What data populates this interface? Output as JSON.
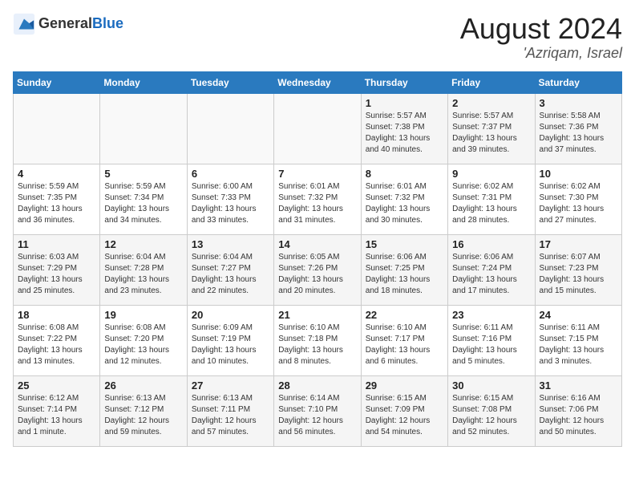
{
  "header": {
    "logo_general": "General",
    "logo_blue": "Blue",
    "month_year": "August 2024",
    "location": "'Azriqam, Israel"
  },
  "days_of_week": [
    "Sunday",
    "Monday",
    "Tuesday",
    "Wednesday",
    "Thursday",
    "Friday",
    "Saturday"
  ],
  "weeks": [
    [
      {
        "day": "",
        "sunrise": "",
        "sunset": "",
        "daylight": ""
      },
      {
        "day": "",
        "sunrise": "",
        "sunset": "",
        "daylight": ""
      },
      {
        "day": "",
        "sunrise": "",
        "sunset": "",
        "daylight": ""
      },
      {
        "day": "",
        "sunrise": "",
        "sunset": "",
        "daylight": ""
      },
      {
        "day": "1",
        "sunrise": "Sunrise: 5:57 AM",
        "sunset": "Sunset: 7:38 PM",
        "daylight": "Daylight: 13 hours and 40 minutes."
      },
      {
        "day": "2",
        "sunrise": "Sunrise: 5:57 AM",
        "sunset": "Sunset: 7:37 PM",
        "daylight": "Daylight: 13 hours and 39 minutes."
      },
      {
        "day": "3",
        "sunrise": "Sunrise: 5:58 AM",
        "sunset": "Sunset: 7:36 PM",
        "daylight": "Daylight: 13 hours and 37 minutes."
      }
    ],
    [
      {
        "day": "4",
        "sunrise": "Sunrise: 5:59 AM",
        "sunset": "Sunset: 7:35 PM",
        "daylight": "Daylight: 13 hours and 36 minutes."
      },
      {
        "day": "5",
        "sunrise": "Sunrise: 5:59 AM",
        "sunset": "Sunset: 7:34 PM",
        "daylight": "Daylight: 13 hours and 34 minutes."
      },
      {
        "day": "6",
        "sunrise": "Sunrise: 6:00 AM",
        "sunset": "Sunset: 7:33 PM",
        "daylight": "Daylight: 13 hours and 33 minutes."
      },
      {
        "day": "7",
        "sunrise": "Sunrise: 6:01 AM",
        "sunset": "Sunset: 7:32 PM",
        "daylight": "Daylight: 13 hours and 31 minutes."
      },
      {
        "day": "8",
        "sunrise": "Sunrise: 6:01 AM",
        "sunset": "Sunset: 7:32 PM",
        "daylight": "Daylight: 13 hours and 30 minutes."
      },
      {
        "day": "9",
        "sunrise": "Sunrise: 6:02 AM",
        "sunset": "Sunset: 7:31 PM",
        "daylight": "Daylight: 13 hours and 28 minutes."
      },
      {
        "day": "10",
        "sunrise": "Sunrise: 6:02 AM",
        "sunset": "Sunset: 7:30 PM",
        "daylight": "Daylight: 13 hours and 27 minutes."
      }
    ],
    [
      {
        "day": "11",
        "sunrise": "Sunrise: 6:03 AM",
        "sunset": "Sunset: 7:29 PM",
        "daylight": "Daylight: 13 hours and 25 minutes."
      },
      {
        "day": "12",
        "sunrise": "Sunrise: 6:04 AM",
        "sunset": "Sunset: 7:28 PM",
        "daylight": "Daylight: 13 hours and 23 minutes."
      },
      {
        "day": "13",
        "sunrise": "Sunrise: 6:04 AM",
        "sunset": "Sunset: 7:27 PM",
        "daylight": "Daylight: 13 hours and 22 minutes."
      },
      {
        "day": "14",
        "sunrise": "Sunrise: 6:05 AM",
        "sunset": "Sunset: 7:26 PM",
        "daylight": "Daylight: 13 hours and 20 minutes."
      },
      {
        "day": "15",
        "sunrise": "Sunrise: 6:06 AM",
        "sunset": "Sunset: 7:25 PM",
        "daylight": "Daylight: 13 hours and 18 minutes."
      },
      {
        "day": "16",
        "sunrise": "Sunrise: 6:06 AM",
        "sunset": "Sunset: 7:24 PM",
        "daylight": "Daylight: 13 hours and 17 minutes."
      },
      {
        "day": "17",
        "sunrise": "Sunrise: 6:07 AM",
        "sunset": "Sunset: 7:23 PM",
        "daylight": "Daylight: 13 hours and 15 minutes."
      }
    ],
    [
      {
        "day": "18",
        "sunrise": "Sunrise: 6:08 AM",
        "sunset": "Sunset: 7:22 PM",
        "daylight": "Daylight: 13 hours and 13 minutes."
      },
      {
        "day": "19",
        "sunrise": "Sunrise: 6:08 AM",
        "sunset": "Sunset: 7:20 PM",
        "daylight": "Daylight: 13 hours and 12 minutes."
      },
      {
        "day": "20",
        "sunrise": "Sunrise: 6:09 AM",
        "sunset": "Sunset: 7:19 PM",
        "daylight": "Daylight: 13 hours and 10 minutes."
      },
      {
        "day": "21",
        "sunrise": "Sunrise: 6:10 AM",
        "sunset": "Sunset: 7:18 PM",
        "daylight": "Daylight: 13 hours and 8 minutes."
      },
      {
        "day": "22",
        "sunrise": "Sunrise: 6:10 AM",
        "sunset": "Sunset: 7:17 PM",
        "daylight": "Daylight: 13 hours and 6 minutes."
      },
      {
        "day": "23",
        "sunrise": "Sunrise: 6:11 AM",
        "sunset": "Sunset: 7:16 PM",
        "daylight": "Daylight: 13 hours and 5 minutes."
      },
      {
        "day": "24",
        "sunrise": "Sunrise: 6:11 AM",
        "sunset": "Sunset: 7:15 PM",
        "daylight": "Daylight: 13 hours and 3 minutes."
      }
    ],
    [
      {
        "day": "25",
        "sunrise": "Sunrise: 6:12 AM",
        "sunset": "Sunset: 7:14 PM",
        "daylight": "Daylight: 13 hours and 1 minute."
      },
      {
        "day": "26",
        "sunrise": "Sunrise: 6:13 AM",
        "sunset": "Sunset: 7:12 PM",
        "daylight": "Daylight: 12 hours and 59 minutes."
      },
      {
        "day": "27",
        "sunrise": "Sunrise: 6:13 AM",
        "sunset": "Sunset: 7:11 PM",
        "daylight": "Daylight: 12 hours and 57 minutes."
      },
      {
        "day": "28",
        "sunrise": "Sunrise: 6:14 AM",
        "sunset": "Sunset: 7:10 PM",
        "daylight": "Daylight: 12 hours and 56 minutes."
      },
      {
        "day": "29",
        "sunrise": "Sunrise: 6:15 AM",
        "sunset": "Sunset: 7:09 PM",
        "daylight": "Daylight: 12 hours and 54 minutes."
      },
      {
        "day": "30",
        "sunrise": "Sunrise: 6:15 AM",
        "sunset": "Sunset: 7:08 PM",
        "daylight": "Daylight: 12 hours and 52 minutes."
      },
      {
        "day": "31",
        "sunrise": "Sunrise: 6:16 AM",
        "sunset": "Sunset: 7:06 PM",
        "daylight": "Daylight: 12 hours and 50 minutes."
      }
    ]
  ]
}
